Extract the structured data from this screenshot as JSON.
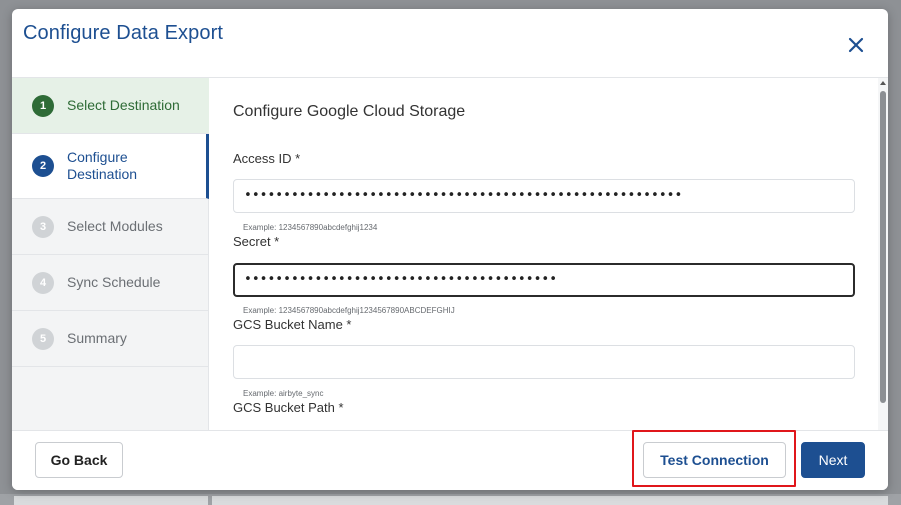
{
  "modal": {
    "title": "Configure Data Export",
    "close_icon": "close-icon"
  },
  "steps": [
    {
      "number": "1",
      "label": "Select Destination",
      "state": "done"
    },
    {
      "number": "2",
      "label": "Configure Destination",
      "state": "active"
    },
    {
      "number": "3",
      "label": "Select Modules",
      "state": "pending"
    },
    {
      "number": "4",
      "label": "Sync Schedule",
      "state": "pending"
    },
    {
      "number": "5",
      "label": "Summary",
      "state": "pending"
    }
  ],
  "form": {
    "section_title": "Configure Google Cloud Storage",
    "fields": [
      {
        "label": "Access ID *",
        "value": "••••••••••••••••••••••••••••••••••••••••••••••••••••••••",
        "placeholder": "",
        "hint": "Example: 1234567890abcdefghij1234"
      },
      {
        "label": "Secret *",
        "value": "••••••••••••••••••••••••••••••••••••••••",
        "placeholder": "",
        "hint": "Example: 1234567890abcdefghij1234567890ABCDEFGHIJ"
      },
      {
        "label": "GCS Bucket Name *",
        "value": "",
        "placeholder": "",
        "hint": "Example: airbyte_sync"
      },
      {
        "label": "GCS Bucket Path *"
      }
    ]
  },
  "footer": {
    "go_back_label": "Go Back",
    "test_connection_label": "Test Connection",
    "next_label": "Next"
  },
  "colors": {
    "primary": "#1d4f91",
    "success": "#2e6b36",
    "highlight": "#e0161b"
  }
}
